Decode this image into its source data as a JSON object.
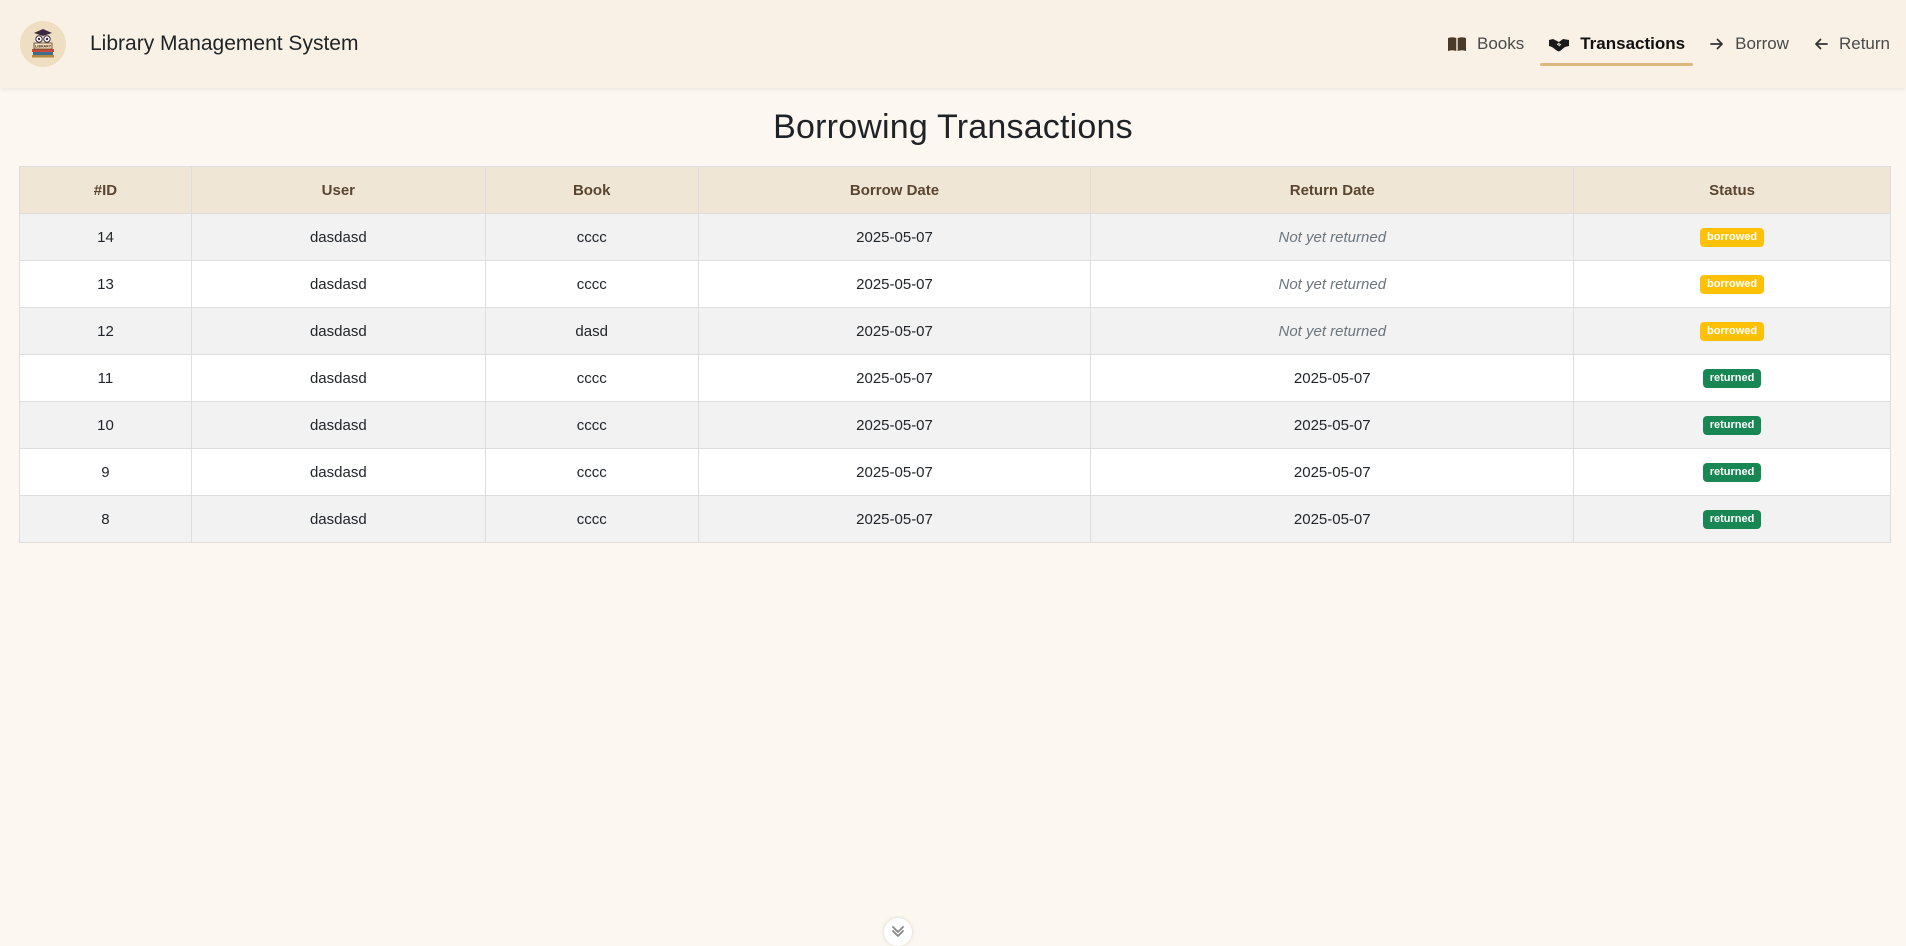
{
  "app": {
    "title": "Library Management System",
    "logo_text": "LIBRARY"
  },
  "nav": {
    "items": [
      {
        "label": "Books",
        "icon": "book-open-icon",
        "active": false
      },
      {
        "label": "Transactions",
        "icon": "handshake-icon",
        "active": true
      },
      {
        "label": "Borrow",
        "icon": "arrow-right-icon",
        "active": false
      },
      {
        "label": "Return",
        "icon": "arrow-left-icon",
        "active": false
      }
    ]
  },
  "page": {
    "title": "Borrowing Transactions"
  },
  "table": {
    "headers": [
      "#ID",
      "User",
      "Book",
      "Borrow Date",
      "Return Date",
      "Status"
    ],
    "rows": [
      {
        "id": "14",
        "user": "dasdasd",
        "book": "cccc",
        "borrow_date": "2025-05-07",
        "return_date": "Not yet returned",
        "status": "borrowed"
      },
      {
        "id": "13",
        "user": "dasdasd",
        "book": "cccc",
        "borrow_date": "2025-05-07",
        "return_date": "Not yet returned",
        "status": "borrowed"
      },
      {
        "id": "12",
        "user": "dasdasd",
        "book": "dasd",
        "borrow_date": "2025-05-07",
        "return_date": "Not yet returned",
        "status": "borrowed"
      },
      {
        "id": "11",
        "user": "dasdasd",
        "book": "cccc",
        "borrow_date": "2025-05-07",
        "return_date": "2025-05-07",
        "status": "returned"
      },
      {
        "id": "10",
        "user": "dasdasd",
        "book": "cccc",
        "borrow_date": "2025-05-07",
        "return_date": "2025-05-07",
        "status": "returned"
      },
      {
        "id": "9",
        "user": "dasdasd",
        "book": "cccc",
        "borrow_date": "2025-05-07",
        "return_date": "2025-05-07",
        "status": "returned"
      },
      {
        "id": "8",
        "user": "dasdasd",
        "book": "cccc",
        "borrow_date": "2025-05-07",
        "return_date": "2025-05-07",
        "status": "returned"
      }
    ]
  },
  "colors": {
    "navbar_bg": "#f9f1e5",
    "page_bg": "#fcf8f1",
    "active_underline": "#dcb77e",
    "header_bg": "#f0e6d6",
    "borrowed_badge": "#ffc107",
    "returned_badge": "#198754"
  },
  "scroll_hint_icon": "chevron-down-icon"
}
